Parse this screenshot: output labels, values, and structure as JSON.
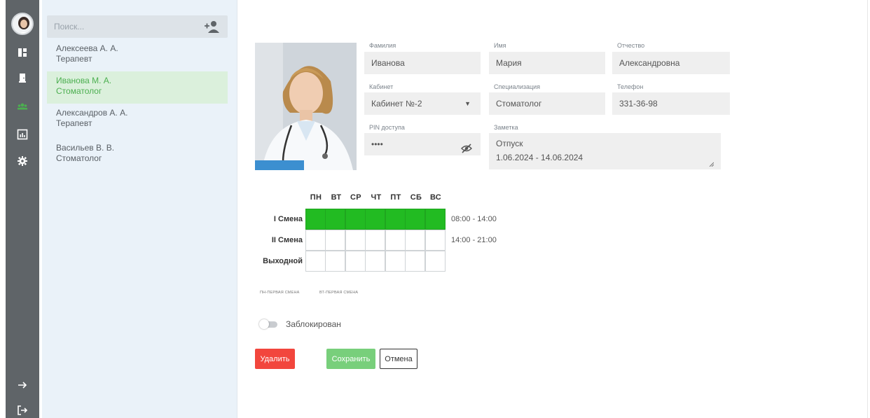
{
  "search": {
    "placeholder": "Поиск..."
  },
  "people": [
    {
      "name": "Алексеева А. А.",
      "role": "Терапевт"
    },
    {
      "name": "Иванова М. А.",
      "role": "Стоматолог"
    },
    {
      "name": "Александров А. А.",
      "role": "Терапевт"
    },
    {
      "name": "Васильев В. В.",
      "role": "Стоматолог"
    }
  ],
  "selected_index": 1,
  "form": {
    "surname": {
      "label": "Фамилия",
      "value": "Иванова"
    },
    "name": {
      "label": "Имя",
      "value": "Мария"
    },
    "patronymic": {
      "label": "Отчество",
      "value": "Александровна"
    },
    "cabinet": {
      "label": "Кабинет",
      "value": "Кабинет №-2"
    },
    "specialization": {
      "label": "Специализация",
      "value": "Стоматолог"
    },
    "phone": {
      "label": "Телефон",
      "value": "331-36-98"
    },
    "pin": {
      "label": "PIN доступа",
      "value": "••••"
    },
    "note": {
      "label": "Заметка",
      "line1": "Отпуск",
      "line2": "1.06.2024 - 14.06.2024"
    }
  },
  "schedule": {
    "days": [
      "ПН",
      "ВТ",
      "СР",
      "ЧТ",
      "ПТ",
      "СБ",
      "ВС"
    ],
    "rows": [
      {
        "label": "I Смена",
        "time": "08:00 - 14:00"
      },
      {
        "label": "II Смена",
        "time": "14:00 - 21:00"
      },
      {
        "label": "Выходной",
        "time": ""
      }
    ],
    "legend": [
      "ПН-ПЕРВАЯ СМЕНА",
      "ВТ-ПЕРВАЯ СМЕНА"
    ]
  },
  "blocked": {
    "label": "Заблокирован",
    "on": false
  },
  "buttons": {
    "delete": "Удалить",
    "save": "Сохранить",
    "cancel": "Отмена"
  },
  "colors": {
    "accent_green": "#22bb22",
    "danger": "#f2463d",
    "save_green": "#78cf7b",
    "rail": "#5f6468",
    "list_bg": "#eaf2f9"
  },
  "icons": [
    "dashboard-icon",
    "door-icon",
    "users-icon",
    "chart-icon",
    "gear-icon",
    "arrow-right-icon",
    "logout-icon",
    "add-user-icon",
    "eye-off-icon"
  ]
}
